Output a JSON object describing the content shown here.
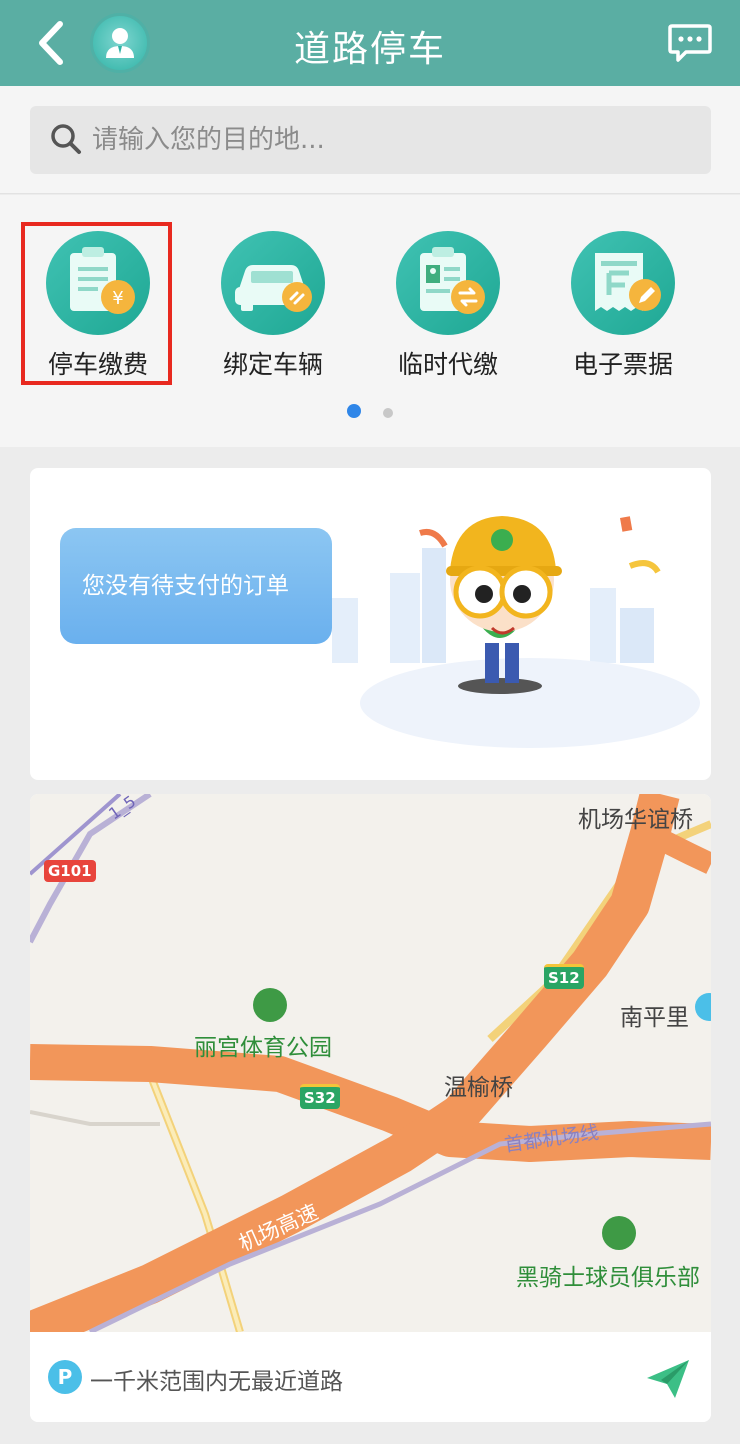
{
  "header": {
    "title": "道路停车"
  },
  "search": {
    "placeholder": "请输入您的目的地..."
  },
  "quick_actions": [
    {
      "label": "停车缴费",
      "icon": "parking-payment-icon",
      "selected": true
    },
    {
      "label": "绑定车辆",
      "icon": "bind-vehicle-icon",
      "selected": false
    },
    {
      "label": "临时代缴",
      "icon": "temporary-payment-icon",
      "selected": false
    },
    {
      "label": "电子票据",
      "icon": "e-receipt-icon",
      "selected": false
    }
  ],
  "pager": {
    "total": 2,
    "active": 1
  },
  "orders": {
    "empty_text": "您没有待支付的订单"
  },
  "map": {
    "labels": {
      "jichang_huayi_bridge": "机场华谊桥",
      "nanpingli": "南平里",
      "ligong_park": "丽宫体育公园",
      "wenyu_bridge": "温榆桥",
      "airport_line": "首都机场线",
      "airport_expressway": "机场高速",
      "knight_club": "黑骑士球员俱乐部",
      "road_15": "1_5"
    },
    "shields": {
      "g101": "G101",
      "s12": "S12",
      "s32": "S32"
    }
  },
  "nearby": {
    "badge": "P",
    "text": "一千米范围内无最近道路"
  },
  "colors": {
    "header": "#5aaea3",
    "accent_teal": "#2fb3a6",
    "highlight_red": "#e8291f",
    "dot_active": "#2f86e8",
    "dot_inactive": "#c8c8c8",
    "highway_orange": "#f2965a",
    "send_green": "#3cbf86"
  }
}
